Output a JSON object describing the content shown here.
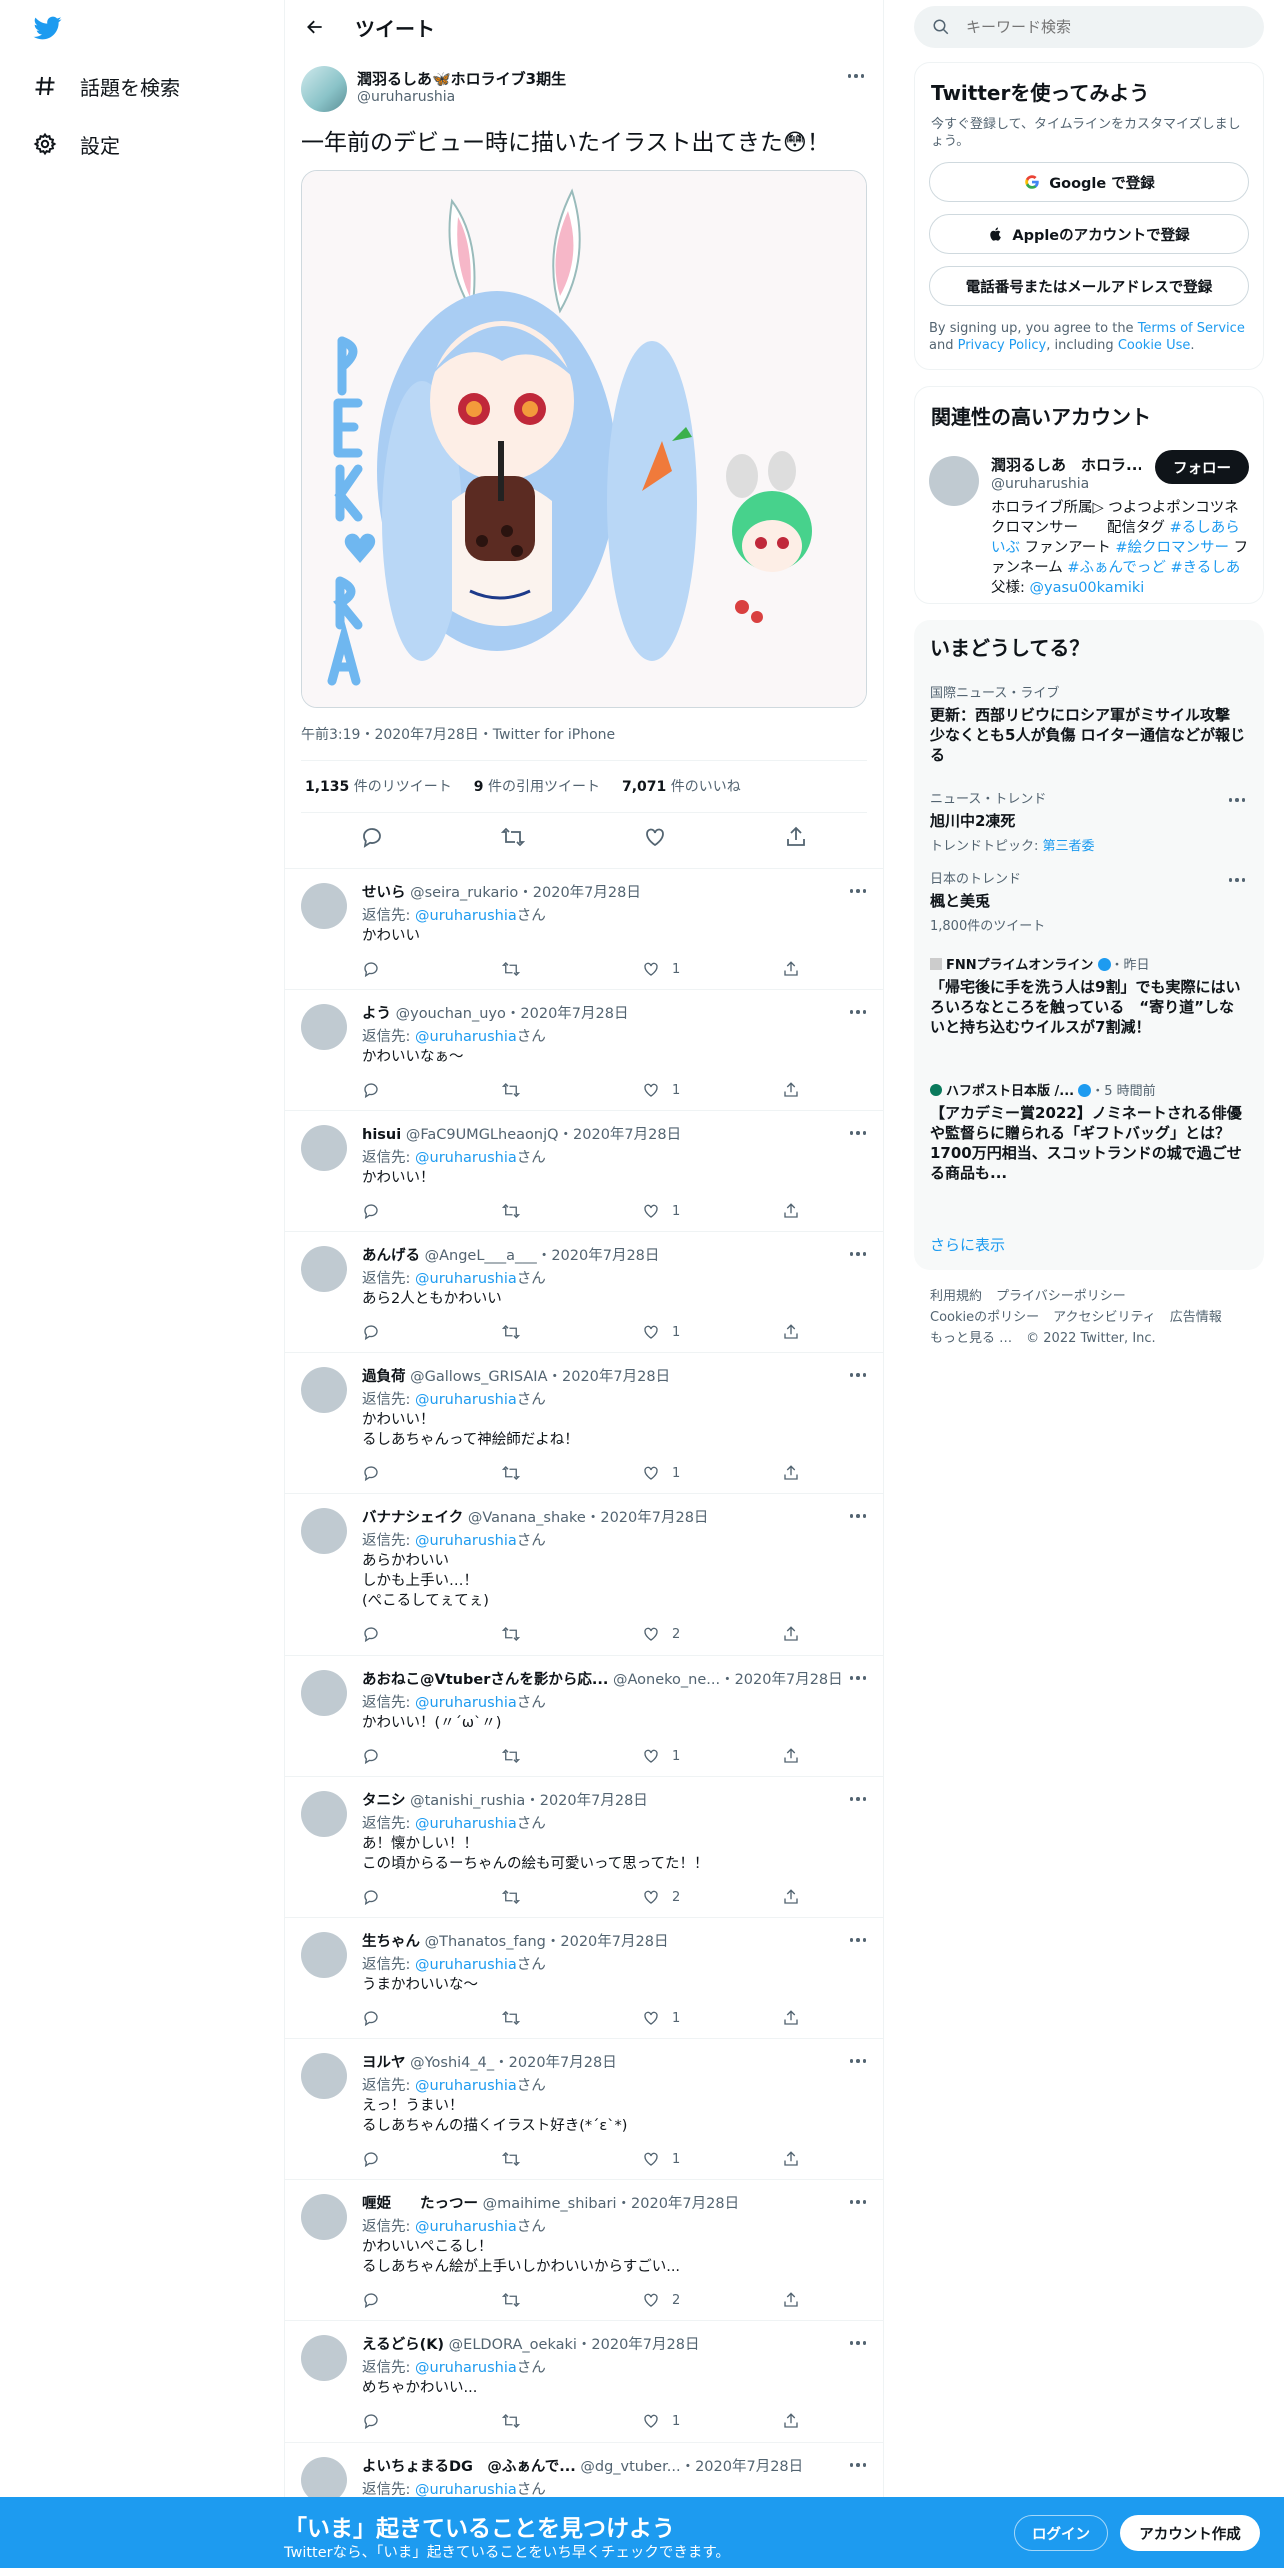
{
  "nav": {
    "explore": "話題を検索",
    "settings": "設定"
  },
  "header": {
    "title": "ツイート"
  },
  "tweet": {
    "name": "潤羽るしあ🦋ホロライブ3期生",
    "handle": "@uruharushia",
    "text": "一年前のデビュー時に描いたイラスト出てきた😳！",
    "meta": "午前3:19・2020年7月28日・Twitter for iPhone",
    "retweets": "1,135",
    "retweets_label": " 件のリツイート",
    "quotes": "9",
    "quotes_label": " 件の引用ツイート",
    "likes": "7,071",
    "likes_label": " 件のいいね"
  },
  "reply_to_label": "返信先: ",
  "reply_to_handle": "@uruharushia",
  "reply_to_suffix": "さん",
  "replies": [
    {
      "name": "せいら",
      "handle": "@seira_rukario",
      "date": "2020年7月28日",
      "text": "かわいい",
      "likes": "1"
    },
    {
      "name": "よう",
      "handle": "@youchan_uyo",
      "date": "2020年7月28日",
      "text": "かわいいなぁ〜",
      "likes": "1"
    },
    {
      "name": "hisui",
      "handle": "@FaC9UMGLheaonjQ",
      "date": "2020年7月28日",
      "text": "かわいい！",
      "likes": "1"
    },
    {
      "name": "あんげる",
      "handle": "@AngeL___a___",
      "date": "2020年7月28日",
      "text": "あら2人ともかわいい",
      "likes": "1"
    },
    {
      "name": "過負荷",
      "handle": "@Gallows_GRISAIA",
      "date": "2020年7月28日",
      "text": "かわいい！\nるしあちゃんって神絵師だよね！",
      "likes": "1"
    },
    {
      "name": "バナナシェイク",
      "handle": "@Vanana_shake",
      "date": "2020年7月28日",
      "text": "あらかわいい\nしかも上手い…！\n(ぺこるしてぇてぇ)",
      "likes": "2"
    },
    {
      "name": "あおねこ@Vtuberさんを影から応...",
      "handle": "@Aoneko_ne...",
      "date": "2020年7月28日",
      "text": "かわいい！(〃´ω`〃)",
      "likes": "1"
    },
    {
      "name": "タニシ",
      "handle": "@tanishi_rushia",
      "date": "2020年7月28日",
      "text": "あ！懐かしい！！\nこの頃からるーちゃんの絵も可愛いって思ってた！！",
      "likes": "2"
    },
    {
      "name": "生ちゃん",
      "handle": "@Thanatos_fang",
      "date": "2020年7月28日",
      "text": "うまかわいいな〜",
      "likes": "1"
    },
    {
      "name": "ヨルヤ",
      "handle": "@Yoshi4_4_",
      "date": "2020年7月28日",
      "text": "えっ！うまい！\nるしあちゃんの描くイラスト好き(*´ε`*)",
      "likes": "1"
    },
    {
      "name": "喱姫　　たっつー",
      "handle": "@maihime_shibari",
      "date": "2020年7月28日",
      "text": "かわいいぺこるし！\nるしあちゃん絵が上手いしかわいいからすごい...",
      "likes": "2"
    },
    {
      "name": "えるどら(K)",
      "handle": "@ELDORA_oekaki",
      "date": "2020年7月28日",
      "text": "めちゃかわいい...",
      "likes": "1"
    },
    {
      "name": "よいちょまるDG　@ふぁんで...",
      "handle": "@dg_vtuber...",
      "date": "2020年7月28日",
      "text": "",
      "likes": ""
    }
  ],
  "search": {
    "placeholder": "キーワード検索"
  },
  "signup": {
    "title": "Twitterを使ってみよう",
    "sub": "今すぐ登録して、タイムラインをカスタマイズしましょう。",
    "google": "Google で登録",
    "apple": "Appleのアカウントで登録",
    "phone": "電話番号またはメールアドレスで登録",
    "terms_pre": "By signing up, you agree to the ",
    "terms_tos": "Terms of Service",
    "terms_and": " and ",
    "terms_privacy": "Privacy Policy",
    "terms_incl": ", including ",
    "terms_cookie": "Cookie Use",
    "terms_end": "."
  },
  "related": {
    "title": "関連性の高いアカウント",
    "name": "潤羽るしあ　ホロラ...",
    "handle": "@uruharushia",
    "follow": "フォロー",
    "bio_a": "ホロライブ所属▷ つよつよポンコツネクロマンサー　　配信タグ ",
    "bio_tag1": "#るしあらいぶ",
    "bio_b": " ファンアート ",
    "bio_tag2": "#絵クロマンサー",
    "bio_c": " ファンネーム ",
    "bio_tag3": "#ふぁんでっど",
    "bio_d": " ",
    "bio_tag4": "#きるしあ",
    "bio_e": " 父様: ",
    "bio_link": "@yasu00kamiki"
  },
  "trends": {
    "title": "いまどうしてる？",
    "items": [
      {
        "category": "国際ニュース・ライブ",
        "title": "更新：西部リビウにロシア軍がミサイル攻撃 少なくとも5人が負傷 ロイター通信などが報じる"
      },
      {
        "category": "ニュース・トレンド",
        "title": "旭川中2凍死",
        "sub_pre": "トレンドトピック: ",
        "sub_link": "第三者委"
      },
      {
        "category": "日本のトレンド",
        "title": "楓と美兎",
        "sub": "1,800件のツイート"
      },
      {
        "source": "FNNプライムオンライン",
        "time": "・昨日",
        "title": "「帰宅後に手を洗う人は9割」でも実際にはいろいろなところを触っている　“寄り道”しないと持ち込むウイルスが7割減！"
      },
      {
        "source": "ハフポスト日本版 /...",
        "time": "・5 時間前",
        "title": "【アカデミー賞2022】ノミネートされる俳優や監督らに贈られる「ギフトバッグ」とは？1700万円相当、スコットランドの城で過ごせる商品も..."
      }
    ],
    "more": "さらに表示"
  },
  "footer": {
    "terms": "利用規約",
    "privacy": "プライバシーポリシー",
    "cookie": "Cookieのポリシー",
    "access": "アクセシビリティ",
    "ads": "広告情報",
    "more": "もっと見る …",
    "copyright": "© 2022 Twitter, Inc."
  },
  "bottom": {
    "title": "「いま」起きていることを見つけよう",
    "sub": "Twitterなら、「いま」起きていることをいち早くチェックできます。",
    "login": "ログイン",
    "signup": "アカウント作成"
  },
  "colors": {
    "accent": "#1d9bf0",
    "text": "#0f1419",
    "muted": "#536471"
  }
}
